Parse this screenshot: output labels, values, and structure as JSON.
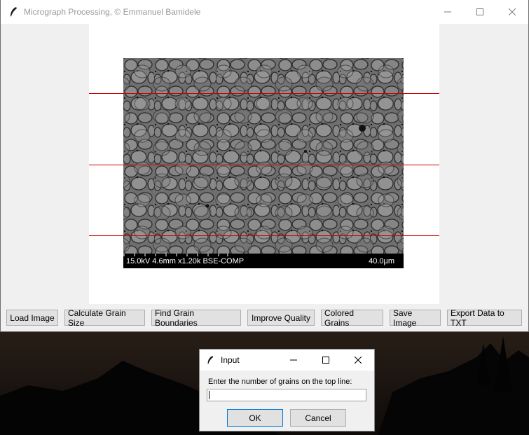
{
  "main_window": {
    "title": "Micrograph Processing,  © Emmanuel Bamidele",
    "icon": "feather-icon",
    "controls": [
      "minimize-icon",
      "maximize-icon",
      "close-icon"
    ]
  },
  "image": {
    "description_icon": "sem-micrograph",
    "info_left": "15.0kV 4.6mm x1.20k BSE-COMP",
    "info_right": "40.0µm",
    "line_color": "#c80000",
    "line_count": 3
  },
  "toolbar": {
    "load_image": "Load Image",
    "calculate_grain_size": "Calculate Grain Size",
    "find_grain_boundaries": "Find Grain Boundaries",
    "improve_quality": "Improve Quality",
    "colored_grains": "Colored Grains",
    "save_image": "Save Image",
    "export_data": "Export Data to TXT"
  },
  "dialog": {
    "title": "Input",
    "prompt": "Enter the number of grains on the top line:",
    "input_value": "",
    "ok_label": "OK",
    "cancel_label": "Cancel"
  }
}
